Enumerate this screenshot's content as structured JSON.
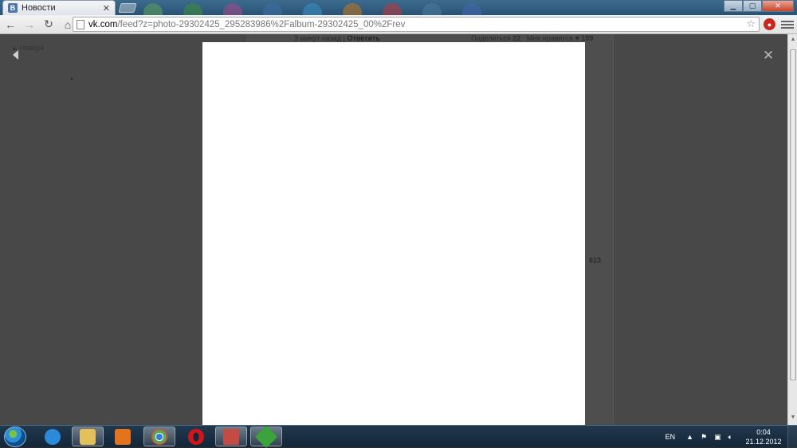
{
  "browser": {
    "tab": {
      "favicon": "В",
      "title": "Новости"
    },
    "url": {
      "host": "vk.com",
      "path": "/feed?z=photo-29302425_295283986%2Falbum-29302425_00%2Frev"
    },
    "controls": {
      "minimize": "▁",
      "maximize": "▢",
      "close": "✕"
    }
  },
  "page": {
    "back_to_top": "Наверх",
    "post_meta": {
      "time_text": "3 минут назад",
      "separator": "|",
      "reply": "Ответить"
    },
    "post_stats": {
      "share": "Поделиться",
      "share_count": "22",
      "likes": "Мне нравится",
      "likes_count": "159"
    },
    "second_count": "613"
  },
  "viewer": {
    "close_symbol": "✕"
  },
  "taskbar": {
    "language": "EN",
    "tray_up": "▲",
    "time": "0:04",
    "date": "21.12.2012",
    "apps": [
      {
        "name": "internet-explorer",
        "color": "#2b8bd8"
      },
      {
        "name": "file-explorer",
        "color": "#e2c15a"
      },
      {
        "name": "media-player",
        "color": "#e3731d"
      },
      {
        "name": "chrome",
        "color": "#4caf50"
      },
      {
        "name": "opera",
        "color": "#d0161c"
      },
      {
        "name": "game-app",
        "color": "#c44a44"
      },
      {
        "name": "green-app",
        "color": "#3aa33a"
      }
    ]
  }
}
